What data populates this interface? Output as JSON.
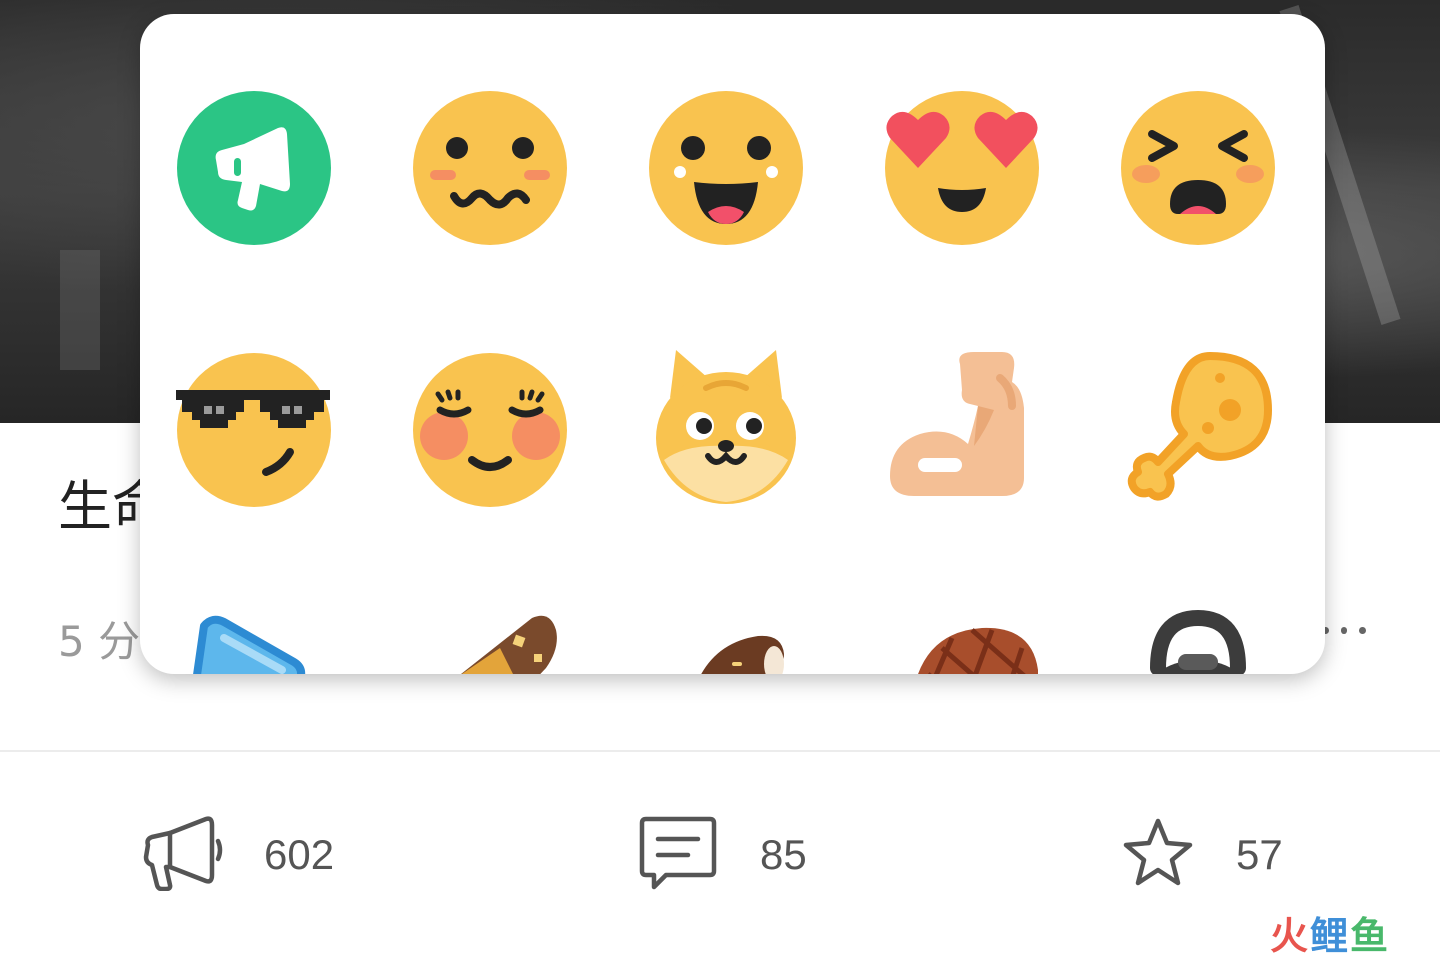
{
  "post": {
    "title_visible": "生命",
    "meta_visible": "5 分"
  },
  "actions": {
    "like_count": "602",
    "comment_count": "85",
    "favorite_count": "57"
  },
  "watermark": {
    "part1": "火",
    "part2": "鲤",
    "part3": "鱼"
  },
  "emoji_panel": {
    "rows": [
      [
        "megaphone-badge",
        "wavy-smile-blush",
        "happy-tongue",
        "heart-eyes",
        "squint-laugh"
      ],
      [
        "cool-sunglasses",
        "content-blush",
        "doge",
        "flexed-biceps",
        "chicken-leg"
      ],
      [
        "blue-bag",
        "chocolate-bar",
        "ice-cream-bar",
        "steak",
        "kettlebell"
      ]
    ]
  },
  "colors": {
    "emoji_yellow": "#F9C34F",
    "emoji_shadow": "#F2B53C",
    "megaphone_green": "#2BC585",
    "heart_red": "#F2505E",
    "blush": "#F58E62",
    "text_gray": "#9A9A9A",
    "icon_gray": "#555555"
  }
}
